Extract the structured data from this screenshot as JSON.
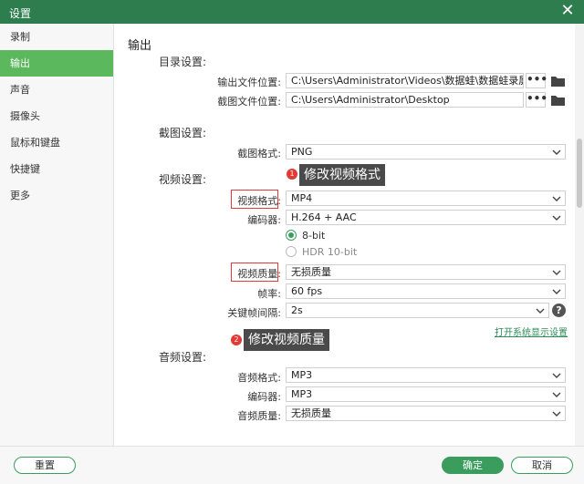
{
  "window": {
    "title": "设置",
    "close_glyph": "✕"
  },
  "sidebar": {
    "items": [
      {
        "label": "录制",
        "active": false
      },
      {
        "label": "输出",
        "active": true
      },
      {
        "label": "声音",
        "active": false
      },
      {
        "label": "摄像头",
        "active": false
      },
      {
        "label": "鼠标和键盘",
        "active": false
      },
      {
        "label": "快捷键",
        "active": false
      },
      {
        "label": "更多",
        "active": false
      }
    ]
  },
  "main": {
    "section_title": "输出",
    "directory": {
      "heading": "目录设置:",
      "output_label": "输出文件位置:",
      "output_value": "C:\\Users\\Administrator\\Videos\\数据蛙\\数据蛙录屏软件",
      "screenshot_label": "截图文件位置:",
      "screenshot_value": "C:\\Users\\Administrator\\Desktop",
      "browse_glyph": "•••"
    },
    "screenshot": {
      "heading": "截图设置:",
      "format_label": "截图格式:",
      "format_value": "PNG"
    },
    "video": {
      "heading": "视频设置:",
      "format_label": "视频格式:",
      "format_value": "MP4",
      "encoder_label": "编码器:",
      "encoder_value": "H.264 + AAC",
      "bit_options": [
        {
          "label": "8-bit",
          "selected": true
        },
        {
          "label": "HDR 10-bit",
          "selected": false
        }
      ],
      "quality_label": "视频质量:",
      "quality_value": "无损质量",
      "fps_label": "帧率:",
      "fps_value": "60 fps",
      "keyframe_label": "关键帧间隔:",
      "keyframe_value": "2s",
      "help_glyph": "?",
      "display_settings_link": "打开系统显示设置"
    },
    "audio": {
      "heading": "音频设置:",
      "format_label": "音频格式:",
      "format_value": "MP3",
      "encoder_label": "编码器:",
      "encoder_value": "MP3",
      "quality_label": "音频质量:",
      "quality_value": "无损质量"
    },
    "annotations": [
      {
        "number": "1",
        "text": "修改视频格式"
      },
      {
        "number": "2",
        "text": "修改视频质量"
      }
    ]
  },
  "footer": {
    "reset_label": "重置",
    "ok_label": "确定",
    "cancel_label": "取消"
  },
  "colors": {
    "titlebar": "#2e7d4f",
    "accent": "#3a9d5d",
    "sidebar_active": "#5cb85c",
    "annotation_red": "#e03a3a"
  }
}
